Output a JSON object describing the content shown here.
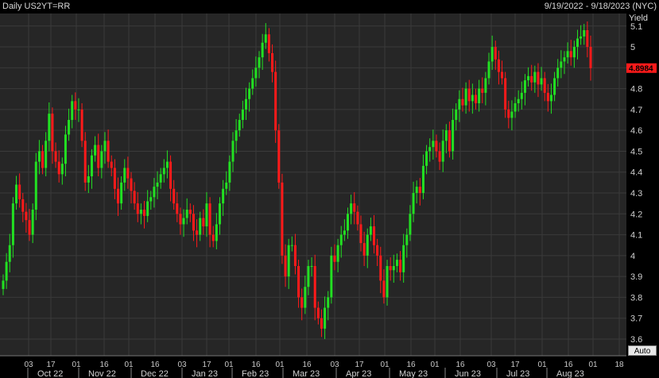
{
  "header": {
    "title": "Daily US2YT=RR",
    "range": "9/19/2022 - 9/18/2023 (NYC)"
  },
  "auto_label": "Auto",
  "colors": {
    "up": "#22e022",
    "down": "#ff1a1a",
    "background": "#262626",
    "grid": "#3a3a3a",
    "last_badge": "#ff1a1a"
  },
  "chart_data": {
    "type": "candlestick",
    "ylabel": "Yield",
    "ylim": [
      3.52,
      5.16
    ],
    "yticks": [
      3.6,
      3.7,
      3.8,
      3.9,
      4,
      4.1,
      4.2,
      4.3,
      4.4,
      4.5,
      4.6,
      4.7,
      4.8,
      4.9,
      5,
      5.1
    ],
    "ytick_labels": [
      "3.6",
      "3.7",
      "3.8",
      "3.9",
      "4",
      "4.1",
      "4.2",
      "4.3",
      "4.4",
      "4.5",
      "4.6",
      "4.7",
      "4.8",
      "4.9",
      "5",
      "5.1"
    ],
    "last_value": 4.8984,
    "last_value_label": "4.8984",
    "xtick_labels": [
      "03",
      "17",
      "01",
      "16",
      "01",
      "16",
      "03",
      "17",
      "01",
      "16",
      "01",
      "16",
      "03",
      "17",
      "01",
      "16",
      "01",
      "16",
      "03",
      "17",
      "01",
      "16",
      "01",
      "18"
    ],
    "month_labels": [
      "Oct 22",
      "Nov 22",
      "Dec 22",
      "Jan 23",
      "Feb 23",
      "Mar 23",
      "Apr 23",
      "May 23",
      "Jun 23",
      "Jul 23",
      "Aug 23"
    ],
    "closes": [
      3.88,
      3.97,
      4.05,
      4.25,
      4.34,
      4.27,
      4.21,
      4.17,
      4.1,
      4.22,
      4.45,
      4.5,
      4.42,
      4.55,
      4.68,
      4.5,
      4.45,
      4.39,
      4.44,
      4.58,
      4.65,
      4.74,
      4.7,
      4.7,
      4.55,
      4.35,
      4.38,
      4.48,
      4.53,
      4.42,
      4.5,
      4.55,
      4.45,
      4.42,
      4.32,
      4.25,
      4.35,
      4.42,
      4.37,
      4.31,
      4.25,
      4.2,
      4.22,
      4.19,
      4.26,
      4.28,
      4.33,
      4.35,
      4.39,
      4.42,
      4.45,
      4.32,
      4.25,
      4.2,
      4.15,
      4.18,
      4.22,
      4.2,
      4.12,
      4.1,
      4.18,
      4.14,
      4.25,
      4.1,
      4.07,
      4.15,
      4.25,
      4.32,
      4.35,
      4.45,
      4.55,
      4.6,
      4.65,
      4.7,
      4.75,
      4.8,
      4.85,
      4.9,
      4.95,
      5.02,
      5.06,
      4.97,
      4.88,
      4.6,
      4.35,
      4.0,
      3.9,
      4.05,
      4.05,
      3.95,
      3.8,
      3.75,
      3.85,
      3.95,
      3.95,
      3.75,
      3.7,
      3.65,
      3.75,
      3.8,
      4.0,
      3.97,
      4.05,
      4.1,
      4.12,
      4.2,
      4.25,
      4.21,
      4.15,
      4.06,
      4.0,
      4.1,
      4.14,
      4.05,
      4.0,
      3.88,
      3.8,
      3.95,
      3.93,
      3.95,
      3.98,
      3.92,
      4.05,
      4.1,
      4.2,
      4.3,
      4.33,
      4.3,
      4.43,
      4.5,
      4.52,
      4.55,
      4.5,
      4.45,
      4.55,
      4.6,
      4.5,
      4.65,
      4.7,
      4.75,
      4.72,
      4.8,
      4.74,
      4.77,
      4.73,
      4.8,
      4.78,
      4.85,
      4.93,
      5.0,
      4.94,
      4.88,
      4.85,
      4.7,
      4.66,
      4.69,
      4.73,
      4.75,
      4.78,
      4.84,
      4.86,
      4.83,
      4.88,
      4.82,
      4.85,
      4.78,
      4.74,
      4.77,
      4.85,
      4.9,
      4.93,
      4.95,
      4.98,
      4.95,
      5.0,
      5.04,
      5.05,
      5.08,
      5.0,
      4.8984
    ]
  }
}
